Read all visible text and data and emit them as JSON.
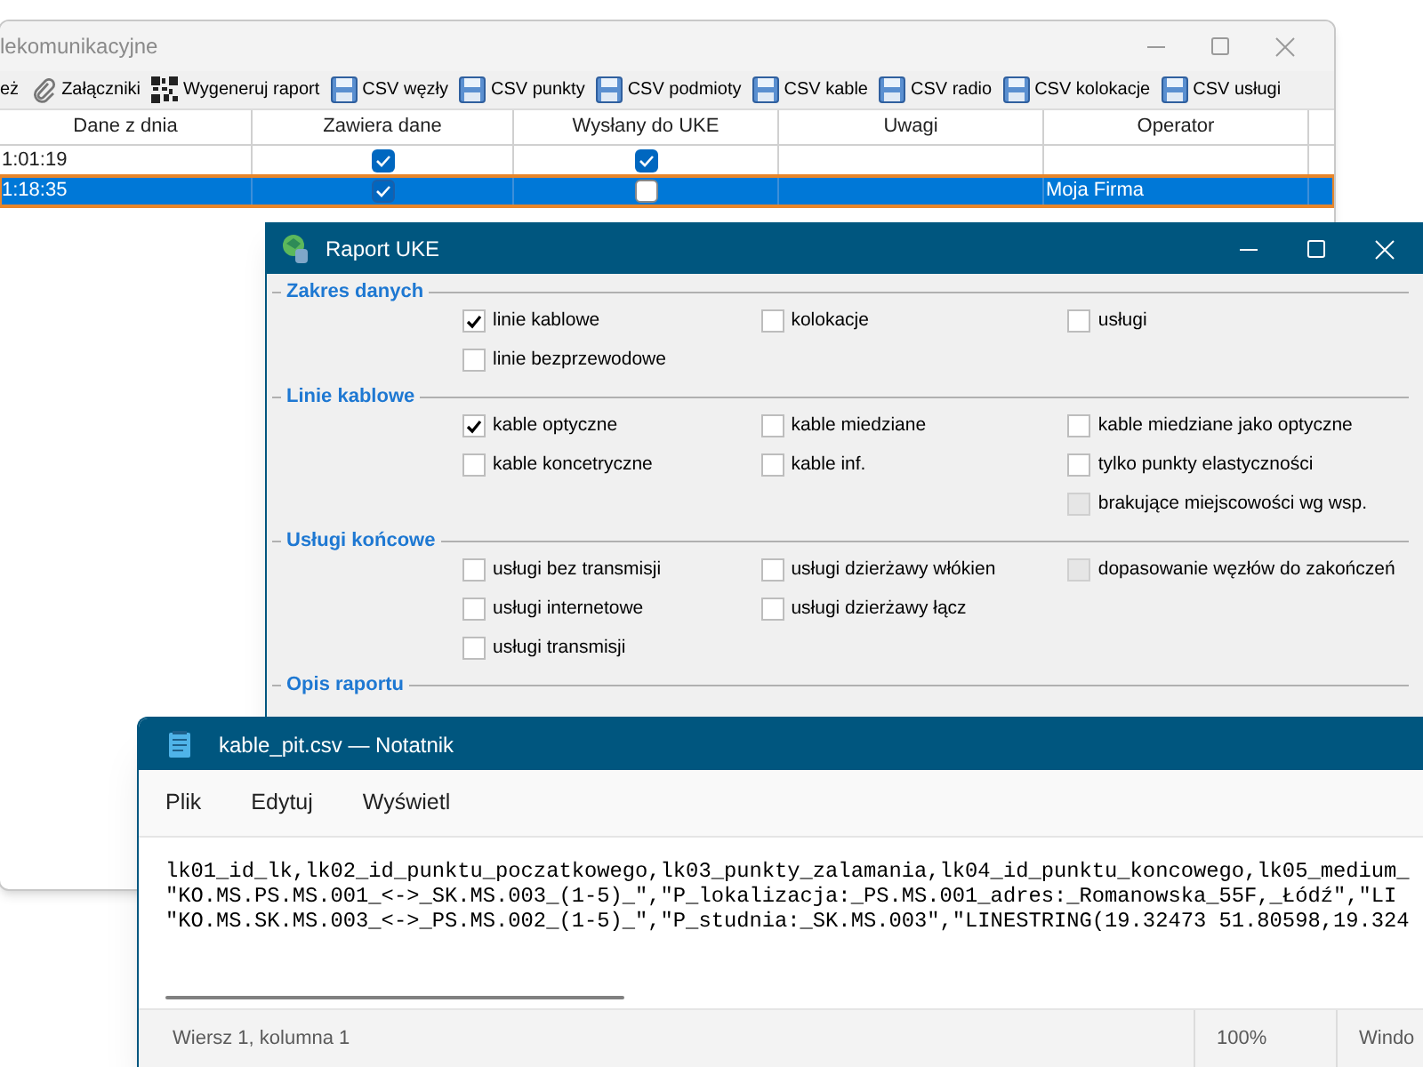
{
  "main_window": {
    "title": "lekomunikacyjne",
    "toolbar": [
      {
        "kind": "text",
        "label": "eż"
      },
      {
        "kind": "paperclip",
        "label": "Załączniki"
      },
      {
        "kind": "qr",
        "label": "Wygeneruj raport"
      },
      {
        "kind": "floppy",
        "label": "CSV węzły"
      },
      {
        "kind": "floppy",
        "label": "CSV punkty"
      },
      {
        "kind": "floppy",
        "label": "CSV podmioty"
      },
      {
        "kind": "floppy",
        "label": "CSV kable"
      },
      {
        "kind": "floppy",
        "label": "CSV radio"
      },
      {
        "kind": "floppy",
        "label": "CSV kolokacje"
      },
      {
        "kind": "floppy",
        "label": "CSV usługi"
      }
    ],
    "table": {
      "columns": [
        "Dane z dnia",
        "Zawiera dane",
        "Wysłany do UKE",
        "Uwagi",
        "Operator"
      ],
      "rows": [
        {
          "date": "1:01:19",
          "contains_data": true,
          "sent": true,
          "operator": "",
          "selected": false
        },
        {
          "date": "1:18:35",
          "contains_data": true,
          "sent": false,
          "operator": "Moja Firma",
          "selected": true
        }
      ]
    }
  },
  "dialog": {
    "title": "Raport UKE",
    "sections": [
      {
        "title": "Zakres danych",
        "columns": [
          [
            {
              "label": "linie kablowe",
              "checked": true,
              "disabled": false
            },
            {
              "label": "linie bezprzewodowe",
              "checked": false,
              "disabled": false
            }
          ],
          [
            {
              "label": "kolokacje",
              "checked": false,
              "disabled": false
            }
          ],
          [
            {
              "label": "usługi",
              "checked": false,
              "disabled": false
            }
          ]
        ]
      },
      {
        "title": "Linie kablowe",
        "columns": [
          [
            {
              "label": "kable optyczne",
              "checked": true,
              "disabled": false
            },
            {
              "label": "kable koncetryczne",
              "checked": false,
              "disabled": false
            }
          ],
          [
            {
              "label": "kable miedziane",
              "checked": false,
              "disabled": false
            },
            {
              "label": "kable inf.",
              "checked": false,
              "disabled": false
            }
          ],
          [
            {
              "label": "kable miedziane jako optyczne",
              "checked": false,
              "disabled": false
            },
            {
              "label": "tylko punkty elastyczności",
              "checked": false,
              "disabled": false
            },
            {
              "label": "brakujące miejscowości wg wsp.",
              "checked": false,
              "disabled": true
            }
          ]
        ]
      },
      {
        "title": "Usługi końcowe",
        "columns": [
          [
            {
              "label": "usługi bez transmisji",
              "checked": false,
              "disabled": false
            },
            {
              "label": "usługi internetowe",
              "checked": false,
              "disabled": false
            },
            {
              "label": "usługi transmisji",
              "checked": false,
              "disabled": false
            }
          ],
          [
            {
              "label": "usługi dzierżawy włókien",
              "checked": false,
              "disabled": false
            },
            {
              "label": "usługi dzierżawy łącz",
              "checked": false,
              "disabled": false
            }
          ],
          [
            {
              "label": "dopasowanie węzłów do zakończeń",
              "checked": false,
              "disabled": true
            }
          ]
        ]
      },
      {
        "title": "Opis raportu"
      }
    ]
  },
  "notepad": {
    "title": "kable_pit.csv — Notatnik",
    "menu": [
      "Plik",
      "Edytuj",
      "Wyświetl"
    ],
    "lines": [
      "lk01_id_lk,lk02_id_punktu_poczatkowego,lk03_punkty_zalamania,lk04_id_punktu_koncowego,lk05_medium_",
      "\"KO.MS.PS.MS.001_<->_SK.MS.003_(1-5)_\",\"P_lokalizacja:_PS.MS.001_adres:_Romanowska_55F,_Łódź\",\"LI",
      "\"KO.MS.SK.MS.003_<->_PS.MS.002_(1-5)_\",\"P_studnia:_SK.MS.003\",\"LINESTRING(19.32473 51.80598,19.324"
    ],
    "status": [
      "Wiersz 1, kolumna 1",
      "100%",
      "Windo"
    ]
  }
}
